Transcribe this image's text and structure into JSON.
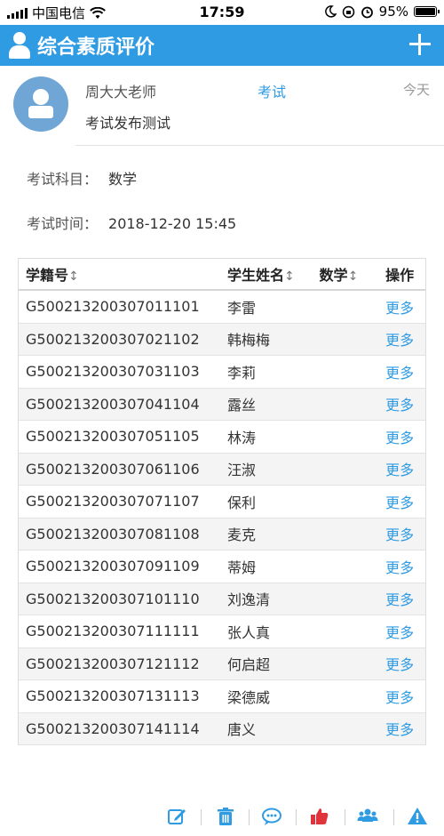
{
  "status_bar": {
    "carrier": "中国电信",
    "time": "17:59",
    "battery": "95%"
  },
  "header": {
    "title": "综合素质评价"
  },
  "post": {
    "author": "周大大老师",
    "category": "考试",
    "time": "今天",
    "title": "考试发布测试"
  },
  "exam": {
    "subject_label": "考试科目：",
    "subject": "数学",
    "time_label": "考试时间：",
    "time": "2018-12-20 15:45"
  },
  "table": {
    "headers": [
      "学籍号",
      "学生姓名",
      "数学",
      "操作"
    ],
    "sort_icon": "↕",
    "rows": [
      {
        "id": "G500213200307011101",
        "name": "李雷",
        "score": "",
        "action": "更多"
      },
      {
        "id": "G500213200307021102",
        "name": "韩梅梅",
        "score": "",
        "action": "更多"
      },
      {
        "id": "G500213200307031103",
        "name": "李莉",
        "score": "",
        "action": "更多"
      },
      {
        "id": "G500213200307041104",
        "name": "露丝",
        "score": "",
        "action": "更多"
      },
      {
        "id": "G500213200307051105",
        "name": "林涛",
        "score": "",
        "action": "更多"
      },
      {
        "id": "G500213200307061106",
        "name": "汪淑",
        "score": "",
        "action": "更多"
      },
      {
        "id": "G500213200307071107",
        "name": "保利",
        "score": "",
        "action": "更多"
      },
      {
        "id": "G500213200307081108",
        "name": "麦克",
        "score": "",
        "action": "更多"
      },
      {
        "id": "G500213200307091109",
        "name": "蒂姆",
        "score": "",
        "action": "更多"
      },
      {
        "id": "G500213200307101110",
        "name": "刘逸清",
        "score": "",
        "action": "更多"
      },
      {
        "id": "G500213200307111111",
        "name": "张人真",
        "score": "",
        "action": "更多"
      },
      {
        "id": "G500213200307121112",
        "name": "何启超",
        "score": "",
        "action": "更多"
      },
      {
        "id": "G500213200307131113",
        "name": "梁德威",
        "score": "",
        "action": "更多"
      },
      {
        "id": "G500213200307141114",
        "name": "唐义",
        "score": "",
        "action": "更多"
      }
    ]
  },
  "toolbar": {
    "icons": [
      "edit-icon",
      "delete-icon",
      "comment-icon",
      "like-icon",
      "group-icon",
      "warning-icon"
    ]
  },
  "colors": {
    "accent": "#2f9be3",
    "like": "#e0343d"
  }
}
